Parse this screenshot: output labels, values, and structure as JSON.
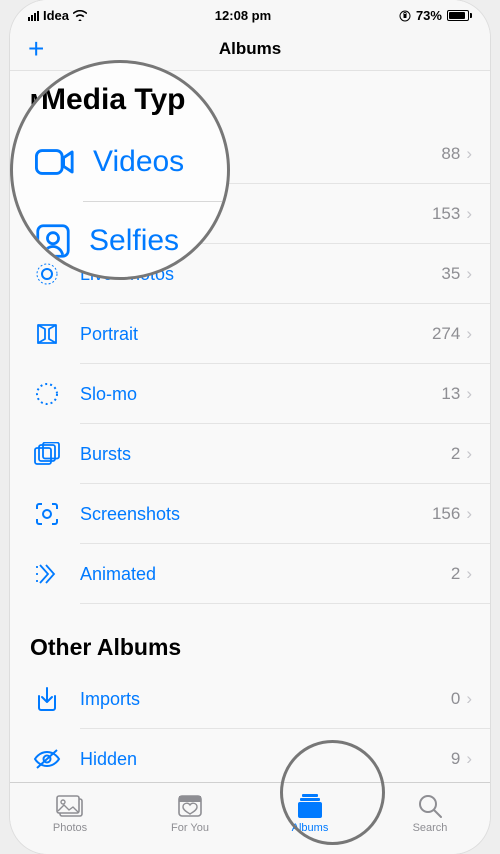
{
  "status_bar": {
    "carrier": "Idea",
    "time": "12:08 pm",
    "battery_pct": "73%"
  },
  "nav": {
    "title": "Albums"
  },
  "section_media_types": {
    "heading": "Media Types",
    "items": [
      {
        "label": "Videos",
        "count": "88"
      },
      {
        "label": "Selfies",
        "count": "153"
      },
      {
        "label": "Live Photos",
        "count": "35"
      },
      {
        "label": "Portrait",
        "count": "274"
      },
      {
        "label": "Slo-mo",
        "count": "13"
      },
      {
        "label": "Bursts",
        "count": "2"
      },
      {
        "label": "Screenshots",
        "count": "156"
      },
      {
        "label": "Animated",
        "count": "2"
      }
    ]
  },
  "section_other_albums": {
    "heading": "Other Albums",
    "items": [
      {
        "label": "Imports",
        "count": "0"
      },
      {
        "label": "Hidden",
        "count": "9"
      }
    ]
  },
  "tabs": {
    "photos": "Photos",
    "foryou": "For You",
    "albums": "Albums",
    "search": "Search"
  },
  "magnify": {
    "heading": "Media Typ",
    "row1": "Videos",
    "row2": "Selfies"
  }
}
